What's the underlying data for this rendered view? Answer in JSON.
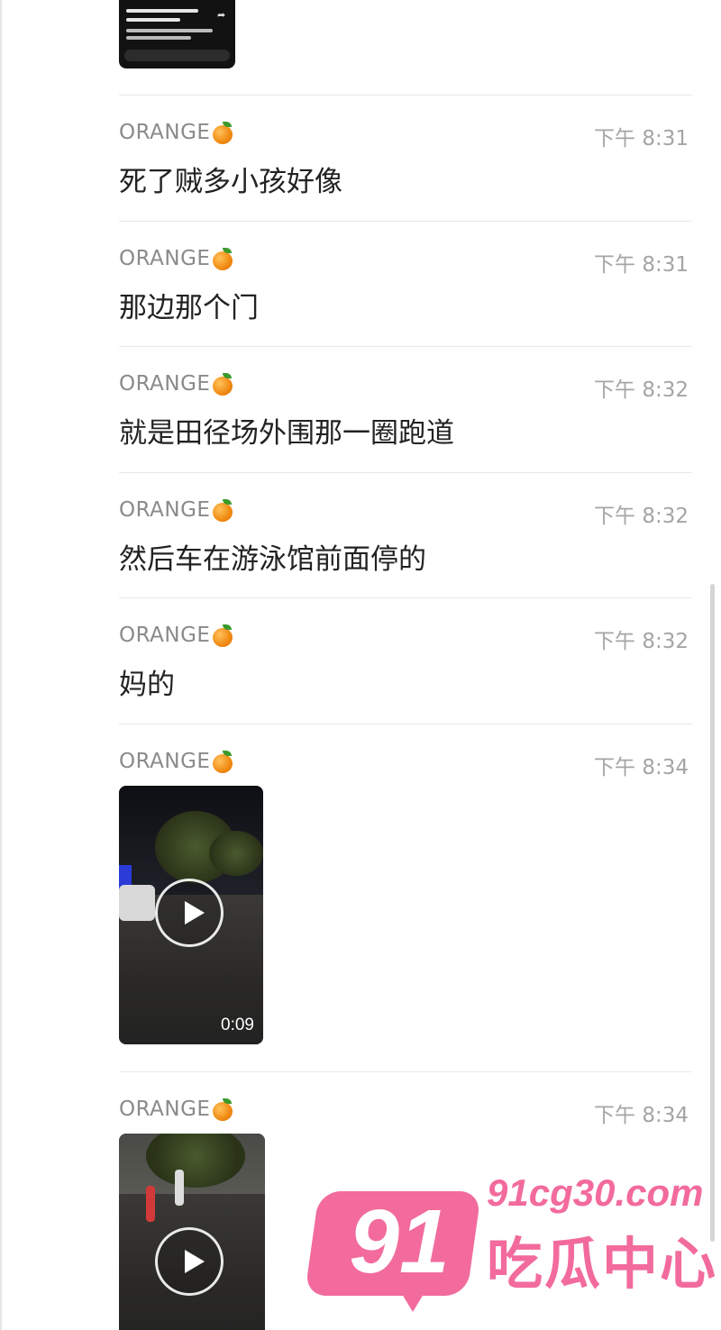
{
  "messages": [
    {
      "sender": "ORANGE",
      "time": "下午 8:31",
      "text": "死了贼多小孩好像"
    },
    {
      "sender": "ORANGE",
      "time": "下午 8:31",
      "text": "那边那个门"
    },
    {
      "sender": "ORANGE",
      "time": "下午 8:32",
      "text": "就是田径场外围那一圈跑道"
    },
    {
      "sender": "ORANGE",
      "time": "下午 8:32",
      "text": "然后车在游泳馆前面停的"
    },
    {
      "sender": "ORANGE",
      "time": "下午 8:32",
      "text": "妈的"
    },
    {
      "sender": "ORANGE",
      "time": "下午 8:34",
      "video_duration": "0:09"
    },
    {
      "sender": "ORANGE",
      "time": "下午 8:34"
    }
  ],
  "icons": {
    "sender_emoji": "orange-icon",
    "video_control": "play-icon"
  },
  "colors": {
    "watermark": "#f26b9c",
    "sender": "#8a8a8a",
    "time": "#a5a5a5"
  },
  "watermark": {
    "number": "91",
    "domain": "91cg30.com",
    "name": "吃瓜中心"
  }
}
